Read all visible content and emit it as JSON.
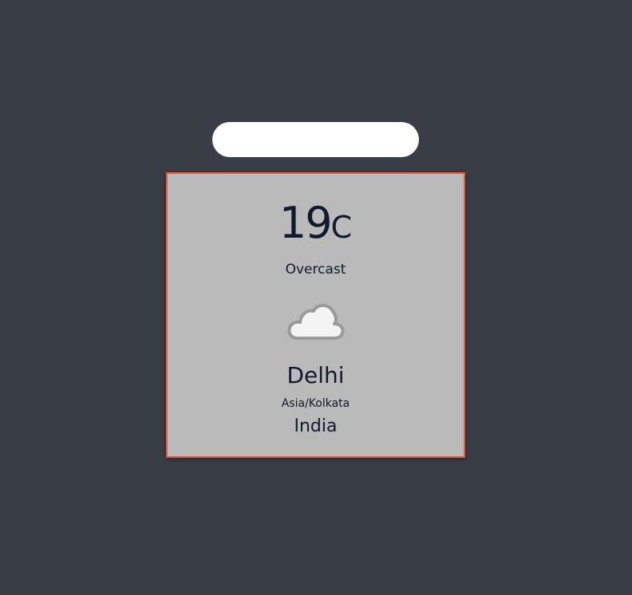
{
  "search": {
    "value": "",
    "placeholder": ""
  },
  "weather": {
    "temperature": "19",
    "unit": "C",
    "condition": "Overcast",
    "icon": "cloud-icon",
    "city": "Delhi",
    "timezone": "Asia/Kolkata",
    "country": "India"
  },
  "colors": {
    "background": "#393e46",
    "card": "#bababa",
    "card_border": "#e8583b",
    "text": "#0f1b2d"
  }
}
